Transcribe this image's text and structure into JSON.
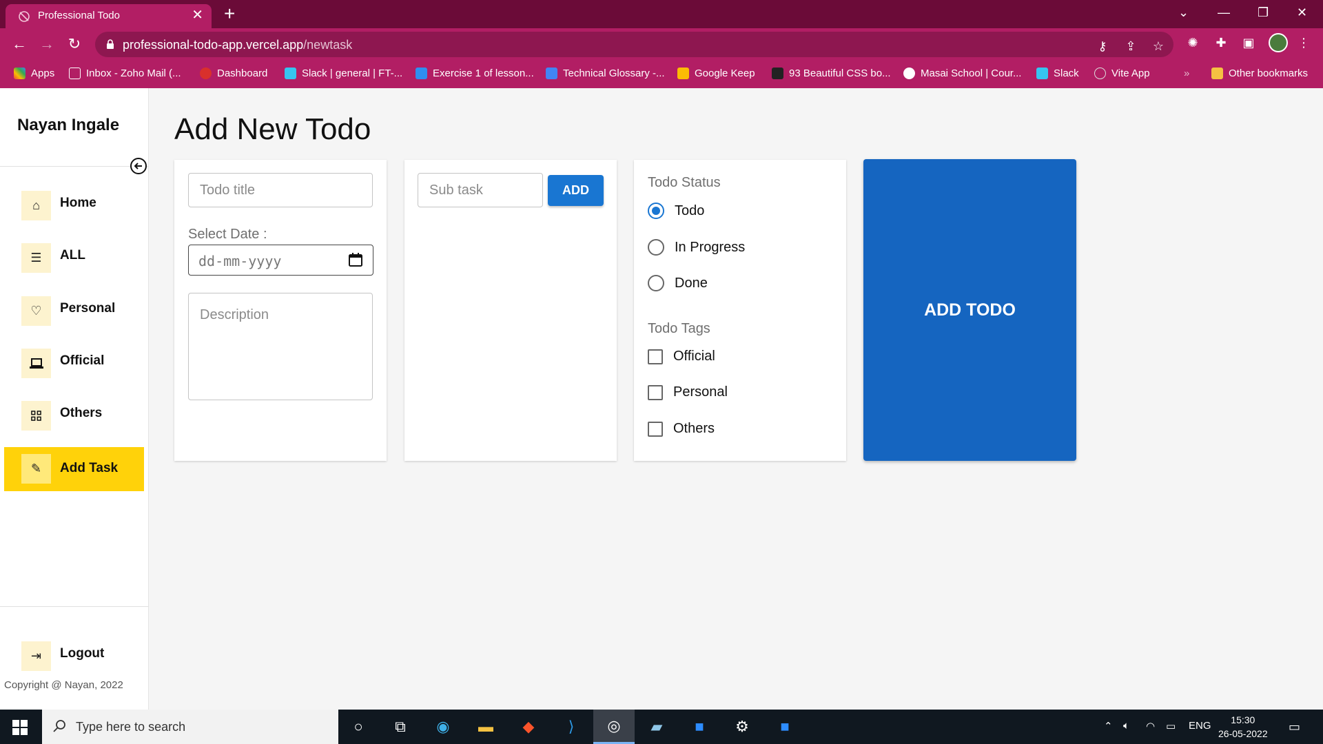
{
  "browser": {
    "tab_title": "Professional Todo",
    "url_host": "professional-todo-app.vercel.app",
    "url_path": "/newtask",
    "bookmarks": [
      {
        "label": "Apps",
        "color": "#e8453c"
      },
      {
        "label": "Inbox - Zoho Mail (...",
        "color": "#ffffff"
      },
      {
        "label": "Dashboard",
        "color": "#d9302c"
      },
      {
        "label": "Slack | general | FT-...",
        "color": "#36c5f0"
      },
      {
        "label": "Exercise 1 of lesson...",
        "color": "#2f8ff0"
      },
      {
        "label": "Technical Glossary -...",
        "color": "#4285f4"
      },
      {
        "label": "Google Keep",
        "color": "#fbbc04"
      },
      {
        "label": "93 Beautiful CSS bo...",
        "color": "#222222"
      },
      {
        "label": "Masai School | Cour...",
        "color": "#ffffff"
      },
      {
        "label": "Slack",
        "color": "#36c5f0"
      },
      {
        "label": "Vite App",
        "color": "#cccccc"
      }
    ],
    "overflow": "»",
    "other_bookmarks": "Other bookmarks"
  },
  "sidebar": {
    "brand": "Nayan Ingale",
    "items": [
      {
        "label": "Home",
        "icon": "home-icon"
      },
      {
        "label": "ALL",
        "icon": "list-icon"
      },
      {
        "label": "Personal",
        "icon": "heart-icon"
      },
      {
        "label": "Official",
        "icon": "laptop-icon"
      },
      {
        "label": "Others",
        "icon": "grid-icon"
      },
      {
        "label": "Add Task",
        "icon": "pencil-icon",
        "active": true
      }
    ],
    "logout": "Logout",
    "copyright": "Copyright @ Nayan, 2022"
  },
  "main": {
    "title": "Add New Todo",
    "form": {
      "title_placeholder": "Todo title",
      "date_label": "Select Date :",
      "date_placeholder": "dd-mm-yyyy",
      "description_placeholder": "Description"
    },
    "subtask": {
      "placeholder": "Sub task",
      "add_label": "ADD"
    },
    "status": {
      "title": "Todo Status",
      "options": [
        "Todo",
        "In Progress",
        "Done"
      ],
      "selected": "Todo"
    },
    "tags": {
      "title": "Todo Tags",
      "options": [
        "Official",
        "Personal",
        "Others"
      ]
    },
    "submit_label": "ADD TODO"
  },
  "colors": {
    "tab_strip": "#6b0b38",
    "toolbar": "#b21e64",
    "active_nav": "#ffd20a",
    "primary": "#1976d2",
    "submit": "#1565c0"
  },
  "taskbar": {
    "search_placeholder": "Type here to search",
    "language": "ENG",
    "time": "15:30",
    "date": "26-05-2022"
  }
}
